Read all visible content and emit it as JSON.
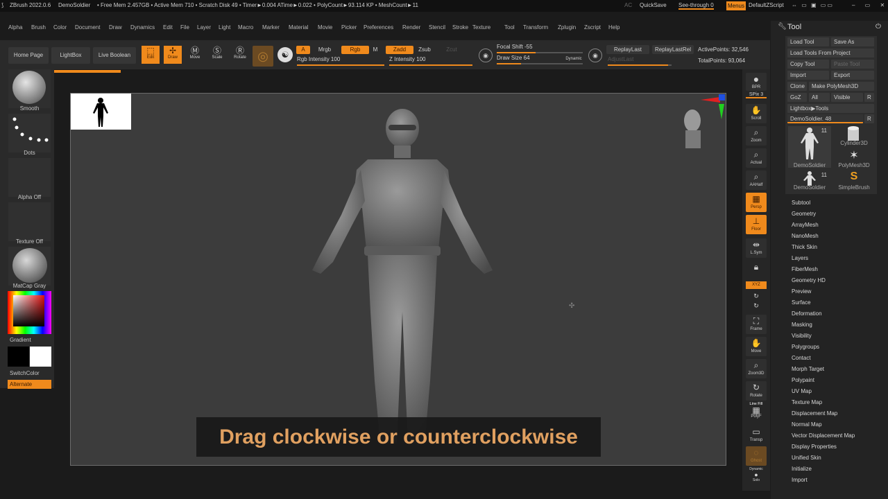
{
  "titlebar": {
    "app": "ZBrush 2022.0.6",
    "doc": "DemoSoldier",
    "stats": "• Free Mem 2.457GB • Active Mem 710 • Scratch Disk 49 • Timer►0.004 ATime►0.022 • PolyCount►93.114 KP • MeshCount►11",
    "ac": "AC",
    "quicksave": "QuickSave",
    "seethrough": "See-through  0",
    "menus": "Menus",
    "script": "DefaultZScript"
  },
  "menubar": [
    "Alpha",
    "Brush",
    "Color",
    "Document",
    "Draw",
    "Dynamics",
    "Edit",
    "File",
    "Layer",
    "Light",
    "Macro",
    "Marker",
    "Material",
    "Movie",
    "Picker",
    "Preferences",
    "Render",
    "Stencil",
    "Stroke",
    "Texture",
    "Tool",
    "Transform",
    "Zplugin",
    "Zscript",
    "Help"
  ],
  "toolbar": {
    "home": "Home Page",
    "lightbox": "LightBox",
    "liveboolean": "Live Boolean",
    "edit": "Edit",
    "draw": "Draw",
    "move": "Move",
    "scale": "Scale",
    "rotate": "Rotate",
    "a": "A",
    "mrgb": "Mrgb",
    "rgb": "Rgb",
    "m": "M",
    "zadd": "Zadd",
    "zsub": "Zsub",
    "zcut": "Zcut",
    "rgb_intensity": "Rgb Intensity 100",
    "z_intensity": "Z Intensity 100",
    "focal_shift": "Focal Shift -55",
    "draw_size": "Draw Size 64",
    "dynamic": "Dynamic",
    "replaylast": "ReplayLast",
    "replaylastrel": "ReplayLastRel",
    "adjustlast": "AdjustLast",
    "activepoints": "ActivePoints: 32,546",
    "totalpoints": "TotalPoints: 93,064"
  },
  "leftshelf": {
    "brush": "Smooth",
    "stroke": "Dots",
    "alpha": "Alpha Off",
    "texture": "Texture Off",
    "material": "MatCap Gray",
    "gradient": "Gradient",
    "switchcolor": "SwitchColor",
    "alternate": "Alternate"
  },
  "viewport": {
    "subtitle": "Drag clockwise or counterclockwise"
  },
  "rightshelf": {
    "bpr": "BPR",
    "spix": "SPix 3",
    "scroll": "Scroll",
    "zoom": "Zoom",
    "actual": "Actual",
    "aahalf": "AAHalf",
    "persp": "Persp",
    "floor": "Floor",
    "lsym": "L.Sym",
    "xyz": "XYZ",
    "frame": "Frame",
    "move": "Move",
    "zoom3d": "Zoom3D",
    "rotate": "Rotate",
    "linefill": "Line Fill",
    "polyf": "PolyF",
    "transp": "Transp",
    "ghost": "Ghost",
    "dynamic": "Dynamic",
    "solo": "Solo"
  },
  "toolpanel": {
    "title": "Tool",
    "load_tool": "Load Tool",
    "save_as": "Save As",
    "load_from_project": "Load Tools From Project",
    "copy_tool": "Copy Tool",
    "paste_tool": "Paste Tool",
    "import": "Import",
    "export": "Export",
    "clone": "Clone",
    "make_polymesh": "Make PolyMesh3D",
    "goz": "GoZ",
    "all": "All",
    "visible": "Visible",
    "r": "R",
    "lightbox_tools": "Lightbox▶Tools",
    "current_tool": "DemoSoldier. 48",
    "thumbs": [
      {
        "label": "DemoSoldier",
        "count": "11"
      },
      {
        "label": "Cylinder3D",
        "count": ""
      },
      {
        "label": "PolyMesh3D",
        "count": ""
      },
      {
        "label": "DemoSoldier",
        "count": "11"
      },
      {
        "label": "SimpleBrush",
        "count": ""
      }
    ],
    "items": [
      "Subtool",
      "Geometry",
      "ArrayMesh",
      "NanoMesh",
      "Thick Skin",
      "Layers",
      "FiberMesh",
      "Geometry HD",
      "Preview",
      "Surface",
      "Deformation",
      "Masking",
      "Visibility",
      "Polygroups",
      "Contact",
      "Morph Target",
      "Polypaint",
      "UV Map",
      "Texture Map",
      "Displacement Map",
      "Normal Map",
      "Vector Displacement Map",
      "Display Properties",
      "Unified Skin",
      "Initialize",
      "Import"
    ]
  },
  "colors": {
    "accent": "#f08a1c",
    "background": "#1b1b1b",
    "viewport": "#3c3c3c",
    "subtitle_text": "#e0a060"
  }
}
